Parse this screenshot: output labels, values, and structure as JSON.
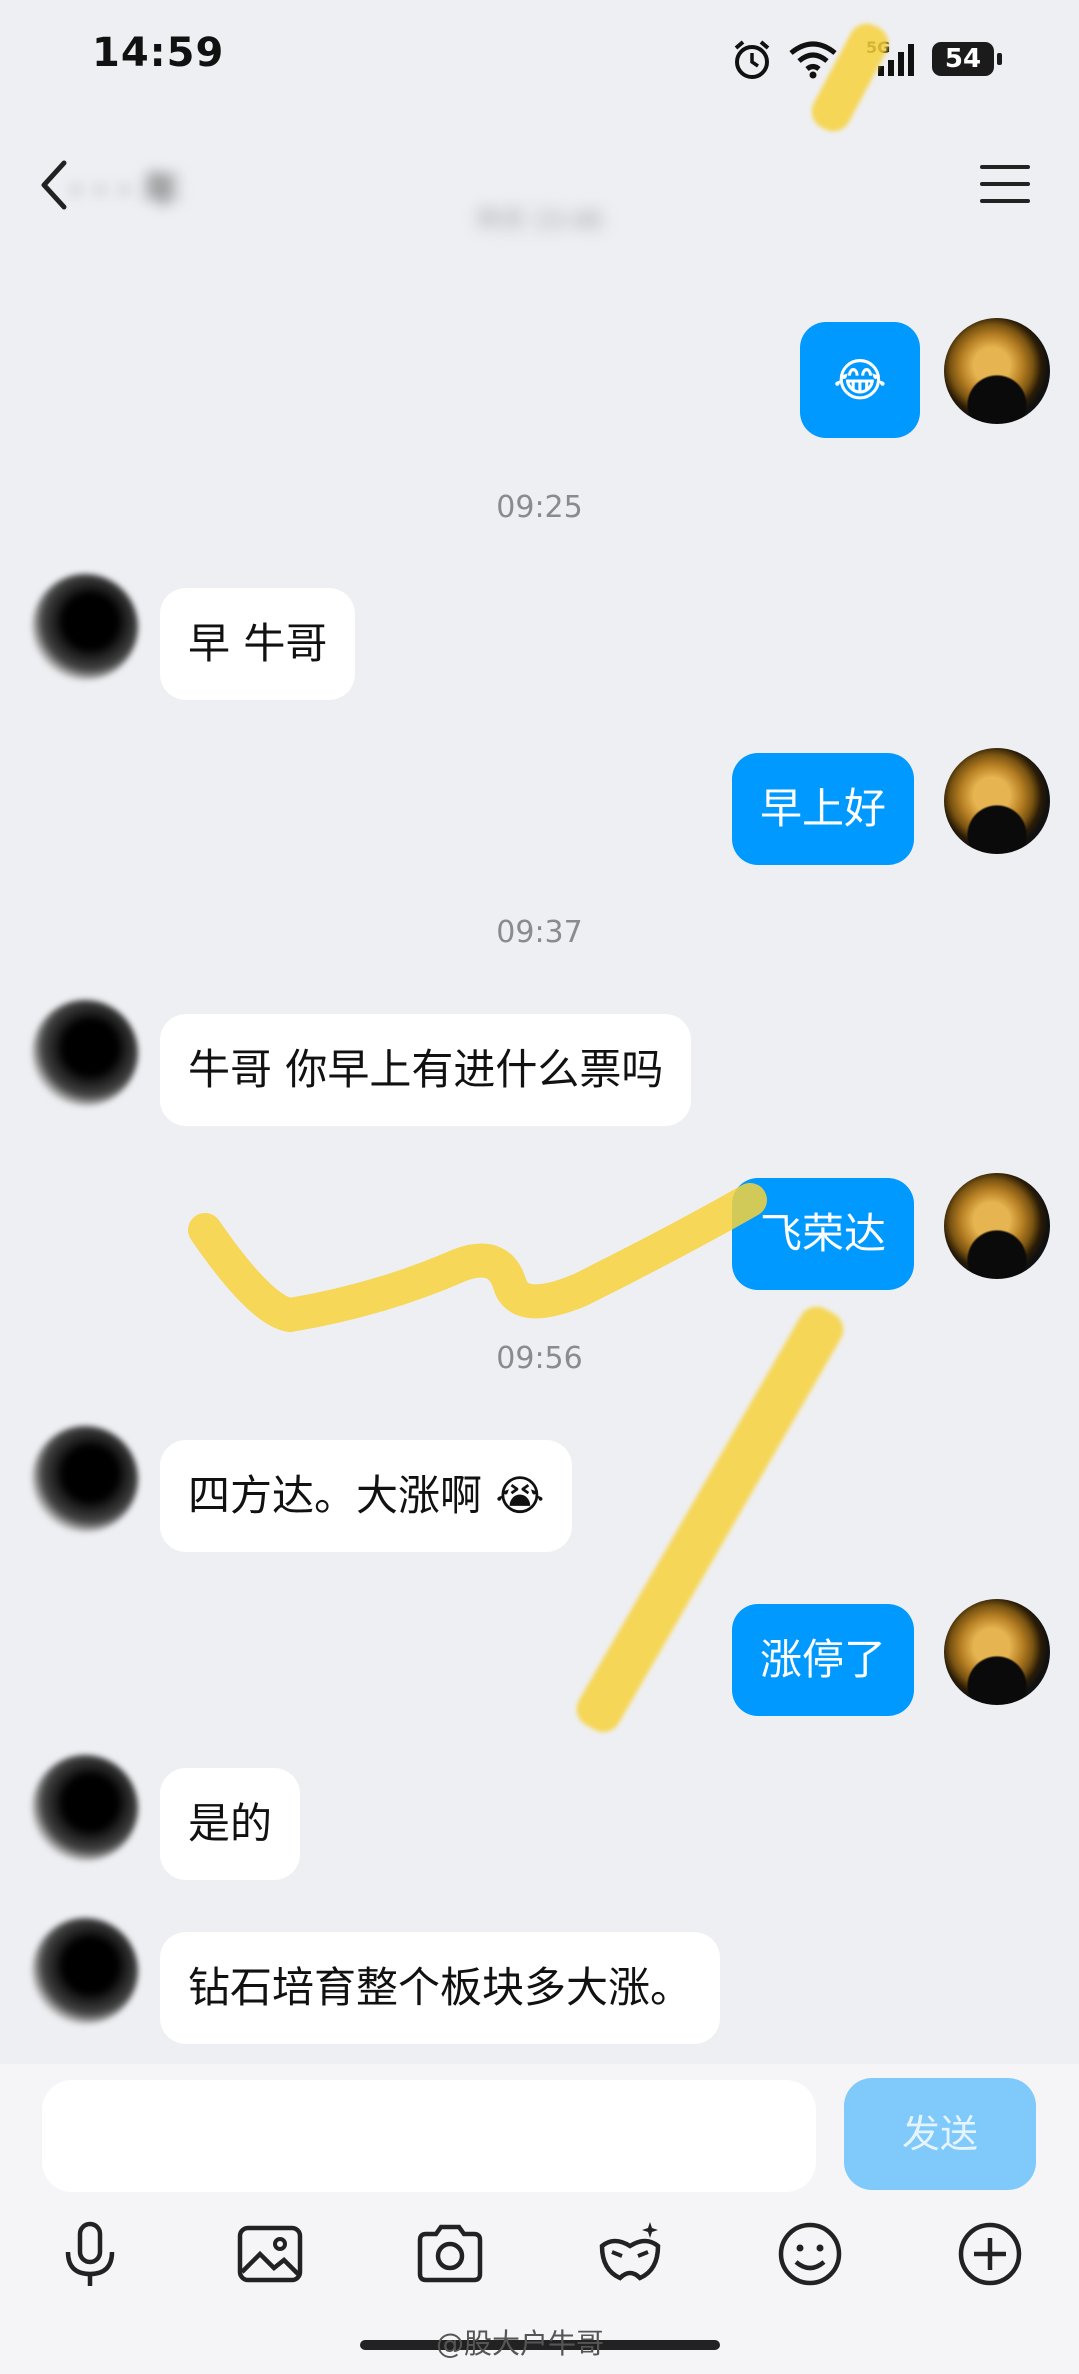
{
  "status_bar": {
    "time": "14:59",
    "network": "5G",
    "battery": "54"
  },
  "header": {
    "title": "· · · 年",
    "subtitle": "昨天 15:46"
  },
  "messages": [
    {
      "type": "outgoing",
      "text": "😂"
    },
    {
      "type": "timestamp",
      "text": "09:25"
    },
    {
      "type": "incoming",
      "text": "早 牛哥"
    },
    {
      "type": "outgoing",
      "text": "早上好"
    },
    {
      "type": "timestamp",
      "text": "09:37"
    },
    {
      "type": "incoming",
      "text": "牛哥 你早上有进什么票吗"
    },
    {
      "type": "outgoing",
      "text": "飞荣达"
    },
    {
      "type": "timestamp",
      "text": "09:56"
    },
    {
      "type": "incoming",
      "text": "四方达。大涨啊 😭"
    },
    {
      "type": "outgoing",
      "text": "涨停了"
    },
    {
      "type": "incoming",
      "text": "是的"
    },
    {
      "type": "incoming",
      "text": "钻石培育整个板块多大涨。"
    }
  ],
  "input": {
    "placeholder": "",
    "send_label": "发送"
  },
  "toolbar": [
    "mic-icon",
    "image-icon",
    "camera-icon",
    "mask-icon",
    "emoji-icon",
    "plus-icon"
  ],
  "watermark": "@股大户牛哥",
  "colors": {
    "outgoing_bubble": "#0099ff",
    "incoming_bubble": "#ffffff",
    "background": "#eeeff3",
    "send_button": "#7fc9fb"
  }
}
